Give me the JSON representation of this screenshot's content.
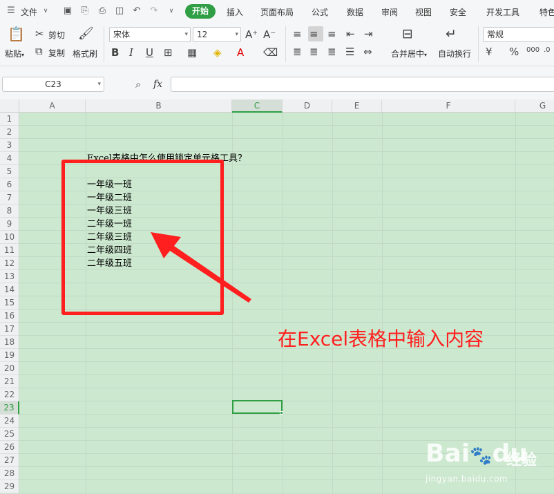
{
  "menubar": {
    "file_label": "文件",
    "tabs": [
      "开始",
      "插入",
      "页面布局",
      "公式",
      "数据",
      "审阅",
      "视图",
      "安全",
      "开发工具",
      "特色"
    ]
  },
  "ribbon": {
    "paste_label": "粘贴",
    "cut_label": "剪切",
    "copy_label": "复制",
    "format_painter_label": "格式刷",
    "font_name": "宋体",
    "font_size": "12",
    "merge_label": "合并居中",
    "wrap_label": "自动换行",
    "number_format": "常规",
    "accent_color": "#2f9e44"
  },
  "formula_bar": {
    "name_box": "C23",
    "fx_label": "fx",
    "formula": ""
  },
  "sheet": {
    "columns": [
      "A",
      "B",
      "C",
      "D",
      "E",
      "F",
      "G"
    ],
    "selected_column": "C",
    "rows": [
      "1",
      "2",
      "3",
      "4",
      "5",
      "6",
      "7",
      "8",
      "9",
      "10",
      "11",
      "12",
      "13",
      "14",
      "15",
      "16",
      "17",
      "18",
      "19",
      "20",
      "21",
      "22",
      "23",
      "24",
      "25",
      "26",
      "27",
      "28",
      "29"
    ],
    "selected_row": "23",
    "cells": {
      "B4": "Excel表格中怎么使用锁定单元格工具？",
      "B6": "一年级一班",
      "B7": "一年级二班",
      "B8": "一年级三班",
      "B9": "二年级一班",
      "B10": "二年级三班",
      "B11": "二年级四班",
      "B12": "二年级五班"
    }
  },
  "annotation": {
    "text": "在Excel表格中输入内容",
    "color": "#ff1f1f"
  },
  "watermark": {
    "logo": "Bai",
    "logo_suffix": "du",
    "jingyan": "经验",
    "url": "jingyan.baidu.com"
  }
}
